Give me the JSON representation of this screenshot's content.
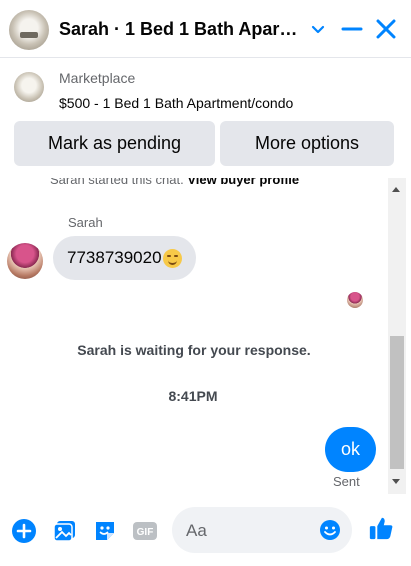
{
  "header": {
    "title": "Sarah · 1 Bed 1 Bath Apartment/condo",
    "icons": [
      "chevron-down-icon",
      "minimize-icon",
      "close-icon"
    ],
    "accent_color": "#0084ff"
  },
  "listing": {
    "label": "Marketplace",
    "title": "$500 - 1 Bed 1 Bath Apartment/condo",
    "buttons": {
      "mark_pending": "Mark as pending",
      "more_options": "More options"
    }
  },
  "chat": {
    "system_prefix": "Sarah started this chat.",
    "system_link": "View buyer profile",
    "sender_name": "Sarah",
    "incoming_message": "7738739020",
    "waiting_notice": "Sarah is waiting for your response.",
    "timestamp": "8:41PM",
    "outgoing_message": "ok",
    "status": "Sent"
  },
  "composer": {
    "placeholder": "Aa",
    "icons": [
      "plus-icon",
      "photo-icon",
      "sticker-icon",
      "gif-icon",
      "emoji-icon",
      "like-icon"
    ]
  }
}
